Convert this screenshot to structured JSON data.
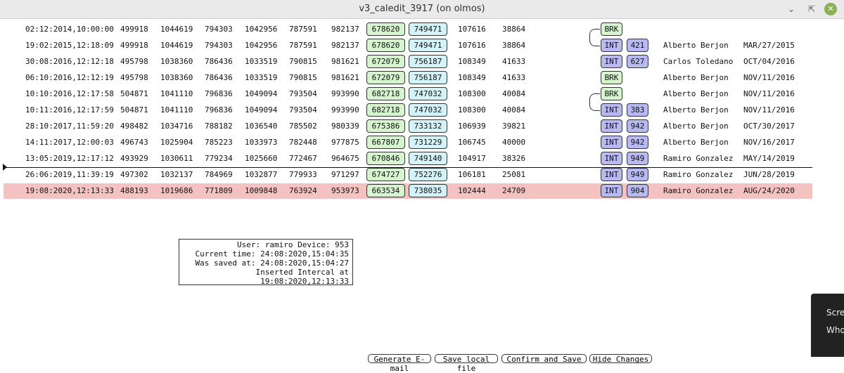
{
  "window": {
    "title": "v3_caledit_3917 (on olmos)",
    "minimize_icon": "chevron-down-icon",
    "maximize_icon": "resize-icon",
    "close_icon": "close-icon",
    "accent_color": "#8bb158"
  },
  "columns_note": "",
  "rows": [
    {
      "datetime": "02:12:2014,10:00:00",
      "c1": "499918",
      "c2": "1044619",
      "c3": "794303",
      "c4": "1042956",
      "c5": "787591",
      "c6": "982137",
      "c7": "678620",
      "c8": "749471",
      "c9": "107616",
      "c10": "38864",
      "type": "BRK",
      "device": "",
      "user": "",
      "date": ""
    },
    {
      "datetime": "19:02:2015,12:18:09",
      "c1": "499918",
      "c2": "1044619",
      "c3": "794303",
      "c4": "1042956",
      "c5": "787591",
      "c6": "982137",
      "c7": "678620",
      "c8": "749471",
      "c9": "107616",
      "c10": "38864",
      "type": "INT",
      "device": "421",
      "user": "Alberto Berjon",
      "date": "MAR/27/2015"
    },
    {
      "datetime": "30:08:2016,12:12:18",
      "c1": "495798",
      "c2": "1038360",
      "c3": "786436",
      "c4": "1033519",
      "c5": "790815",
      "c6": "981621",
      "c7": "672079",
      "c8": "756187",
      "c9": "108349",
      "c10": "41633",
      "type": "INT",
      "device": "627",
      "user": "Carlos Toledano",
      "date": "OCT/04/2016"
    },
    {
      "datetime": "06:10:2016,12:12:19",
      "c1": "495798",
      "c2": "1038360",
      "c3": "786436",
      "c4": "1033519",
      "c5": "790815",
      "c6": "981621",
      "c7": "672079",
      "c8": "756187",
      "c9": "108349",
      "c10": "41633",
      "type": "BRK",
      "device": "",
      "user": "Alberto Berjon",
      "date": "NOV/11/2016"
    },
    {
      "datetime": "10:10:2016,12:17:58",
      "c1": "504871",
      "c2": "1041110",
      "c3": "796836",
      "c4": "1049094",
      "c5": "793504",
      "c6": "993990",
      "c7": "682718",
      "c8": "747032",
      "c9": "108300",
      "c10": "40084",
      "type": "BRK",
      "device": "",
      "user": "Alberto Berjon",
      "date": "NOV/11/2016"
    },
    {
      "datetime": "10:11:2016,12:17:59",
      "c1": "504871",
      "c2": "1041110",
      "c3": "796836",
      "c4": "1049094",
      "c5": "793504",
      "c6": "993990",
      "c7": "682718",
      "c8": "747032",
      "c9": "108300",
      "c10": "40084",
      "type": "INT",
      "device": "383",
      "user": "Alberto Berjon",
      "date": "NOV/11/2016"
    },
    {
      "datetime": "28:10:2017,11:59:20",
      "c1": "498482",
      "c2": "1034716",
      "c3": "788182",
      "c4": "1036540",
      "c5": "785502",
      "c6": "980339",
      "c7": "675386",
      "c8": "733132",
      "c9": "106939",
      "c10": "39821",
      "type": "INT",
      "device": "942",
      "user": "Alberto Berjon",
      "date": "OCT/30/2017"
    },
    {
      "datetime": "14:11:2017,12:00:03",
      "c1": "496743",
      "c2": "1025904",
      "c3": "785223",
      "c4": "1033973",
      "c5": "782448",
      "c6": "977875",
      "c7": "667807",
      "c8": "731229",
      "c9": "106745",
      "c10": "40000",
      "type": "INT",
      "device": "942",
      "user": "Alberto Berjon",
      "date": "NOV/16/2017"
    },
    {
      "datetime": "13:05:2019,12:17:12",
      "c1": "493929",
      "c2": "1030611",
      "c3": "779234",
      "c4": "1025660",
      "c5": "772467",
      "c6": "964675",
      "c7": "670846",
      "c8": "749140",
      "c9": "104917",
      "c10": "38326",
      "type": "INT",
      "device": "949",
      "user": "Ramiro Gonzalez",
      "date": "MAY/14/2019"
    },
    {
      "datetime": "26:06:2019,11:39:19",
      "c1": "497302",
      "c2": "1032137",
      "c3": "784969",
      "c4": "1032877",
      "c5": "779933",
      "c6": "971297",
      "c7": "674727",
      "c8": "752276",
      "c9": "106181",
      "c10": "25081",
      "type": "INT",
      "device": "949",
      "user": "Ramiro Gonzalez",
      "date": "JUN/28/2019"
    },
    {
      "datetime": "19:08:2020,12:13:33",
      "c1": "488193",
      "c2": "1019686",
      "c3": "771809",
      "c4": "1009848",
      "c5": "763924",
      "c6": "953973",
      "c7": "663534",
      "c8": "738035",
      "c9": "102444",
      "c10": "24709",
      "type": "INT",
      "device": "904",
      "user": "Ramiro Gonzalez",
      "date": "AUG/24/2020"
    }
  ],
  "info": {
    "line1": "User: ramiro Device: 953",
    "line2": "Current time: 24:08:2020,15:04:35",
    "line3": "Was saved at: 24:08:2020,15:04:27",
    "line4": "Inserted Intercal at 19:08:2020,12:13:33"
  },
  "buttons": {
    "email": "Generate E-mail",
    "save_local": "Save local file",
    "confirm": "Confirm and Save",
    "hide": "Hide Changes"
  },
  "popup": {
    "line1": "Scre",
    "line2": "Who"
  },
  "colors": {
    "highlight_row": "#f5c2c2",
    "box_green": "#d6f5cf",
    "box_cyan": "#d4f3f8",
    "tag_int": "#b9b9f2",
    "tag_brk": "#d6f5cf"
  }
}
